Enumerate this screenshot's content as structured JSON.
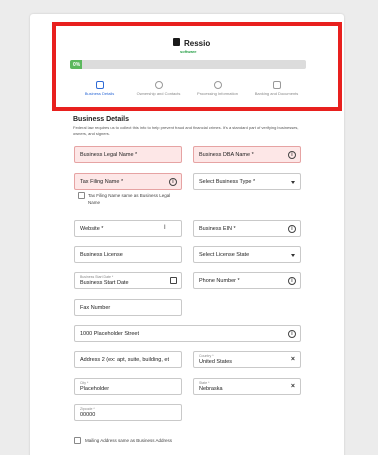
{
  "brand": {
    "name": "Ressio",
    "sub": "software"
  },
  "progress": {
    "label": "0%",
    "value": 0
  },
  "steps": [
    {
      "label": "Business Details"
    },
    {
      "label": "Ownership and Contacts"
    },
    {
      "label": "Processing Information"
    },
    {
      "label": "Banking and Documents"
    }
  ],
  "section": {
    "title": "Business Details",
    "description": "Federal law requires us to collect this info to help prevent fraud and financial crimes. It's a standard part of verifying businesses, owners, and signers."
  },
  "fields": {
    "legal_name": "Business Legal Name *",
    "dba_name": "Business DBA Name *",
    "tax_filing_name": "Tax Filing Name *",
    "business_type": "Select Business Type *",
    "tax_same_label": "Tax Filing Name same as Business Legal Name",
    "website": "Website *",
    "ein": "Business EIN *",
    "license": "Business License",
    "license_state": "Select License State",
    "start_date_label": "Business Start Date *",
    "start_date": "Business Start Date",
    "phone": "Phone Number *",
    "fax": "Fax Number",
    "address1": "1000 Placeholder Street",
    "address2": "Address 2 (ex: apt, suite, building, et",
    "country_label": "Country *",
    "country": "United States",
    "city_label": "City *",
    "city": "Placeholder",
    "state_label": "State *",
    "state": "Nebraska",
    "zip_label": "Zipcode *",
    "zip": "00000",
    "mailing_same_label": "Mailing Address same as Business Address"
  }
}
